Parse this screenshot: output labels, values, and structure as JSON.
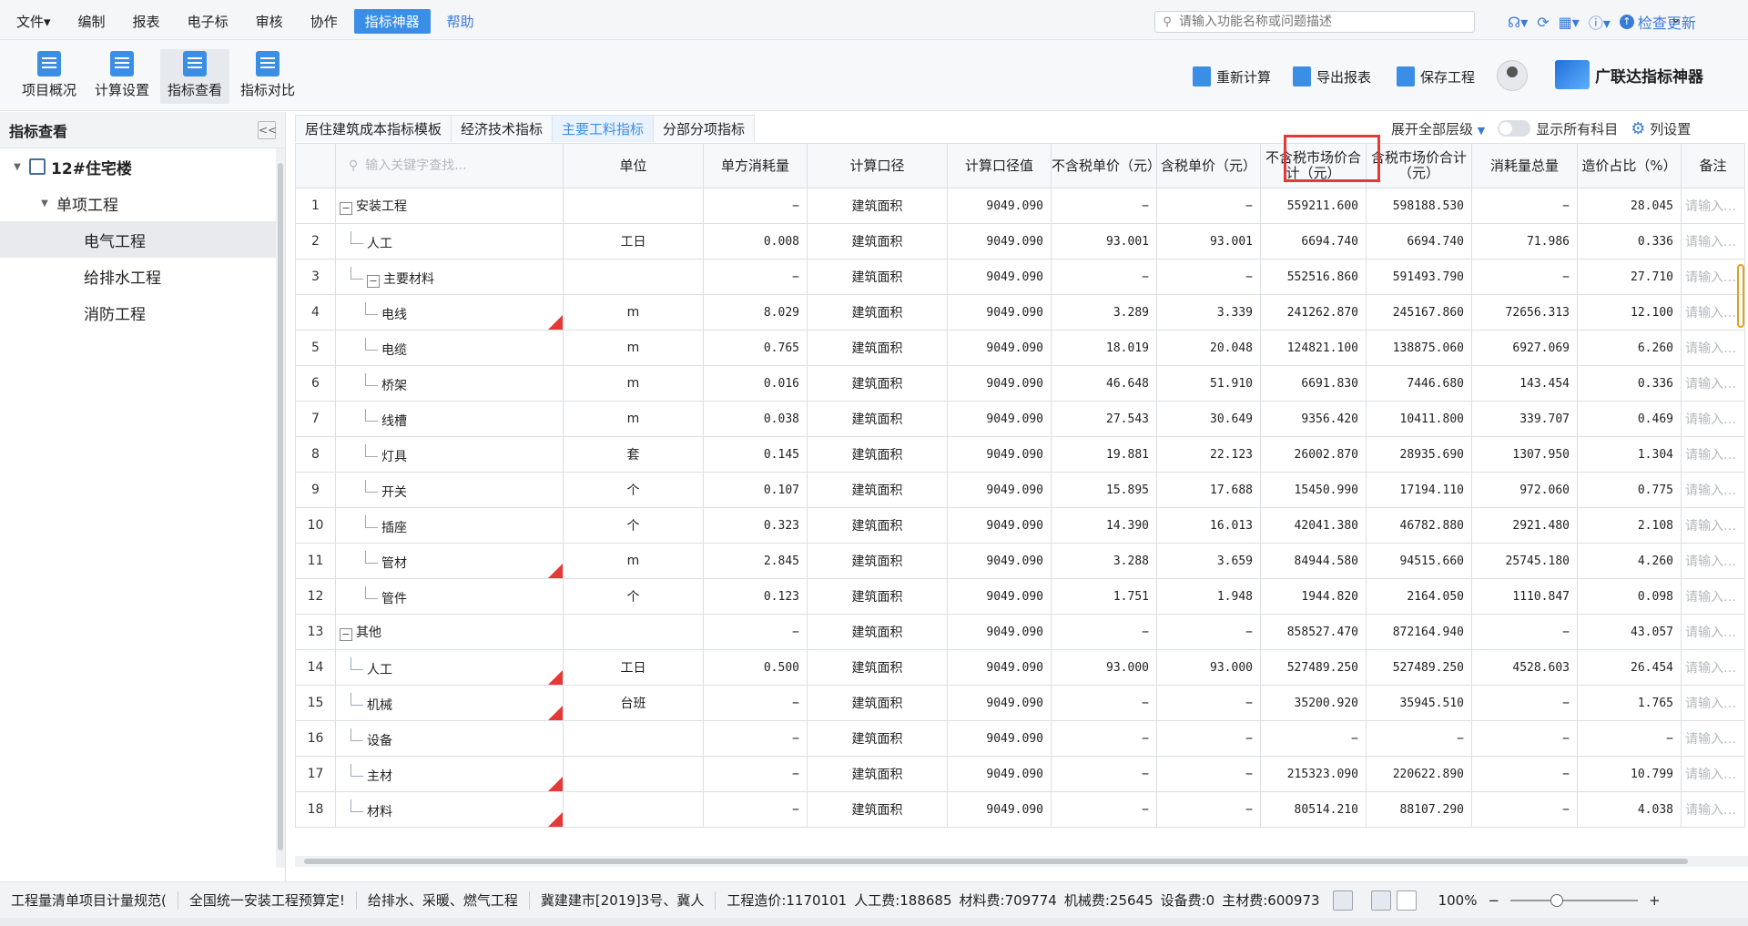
{
  "menubar": {
    "menus": [
      "文件▾",
      "编制",
      "报表",
      "电子标",
      "审核",
      "协作",
      "指标神器",
      "帮助"
    ],
    "active_menu_index": 6,
    "search_placeholder": "请输入功能名称或问题描述",
    "check_update": "检查更新"
  },
  "toolbar": {
    "left_buttons": [
      "项目概况",
      "计算设置",
      "指标查看",
      "指标对比"
    ],
    "active_index": 2,
    "actions": [
      "重新计算",
      "导出报表",
      "保存工程"
    ],
    "brand": "广联达指标神器"
  },
  "leftpanel": {
    "title": "指标查看",
    "collapse": "<<",
    "root": "12#住宅楼",
    "group": "单项工程",
    "items": [
      "电气工程",
      "给排水工程",
      "消防工程"
    ],
    "selected_index": 0
  },
  "tabs": {
    "items": [
      "居住建筑成本指标模板",
      "经济技术指标",
      "主要工料指标",
      "分部分项指标"
    ],
    "active_index": 2,
    "expand_label": "展开全部层级",
    "show_all_label": "显示所有科目",
    "column_settings": "列设置"
  },
  "grid": {
    "search_placeholder": "输入关键字查找...",
    "headers": [
      "单位",
      "单方消耗量",
      "计算口径",
      "计算口径值",
      "不含税单价（元）",
      "含税单价（元）",
      "不含税市场价合计（元）",
      "含税市场价合计（元）",
      "消耗量总量",
      "造价占比（%）",
      "备注"
    ],
    "remark_placeholder": "请输入…",
    "rows": [
      {
        "no": "1",
        "name": "安装工程",
        "level": 0,
        "expand": "−",
        "flag": false,
        "unit": "",
        "per": "−",
        "basis": "建筑面积",
        "bval": "9049.090",
        "p1": "−",
        "p2": "−",
        "t1": "559211.600",
        "t2": "598188.530",
        "qty": "−",
        "pct": "28.045"
      },
      {
        "no": "2",
        "name": "人工",
        "level": 1,
        "expand": "",
        "flag": false,
        "unit": "工日",
        "per": "0.008",
        "basis": "建筑面积",
        "bval": "9049.090",
        "p1": "93.001",
        "p2": "93.001",
        "t1": "6694.740",
        "t2": "6694.740",
        "qty": "71.986",
        "pct": "0.336"
      },
      {
        "no": "3",
        "name": "主要材料",
        "level": 1,
        "expand": "−",
        "flag": false,
        "unit": "",
        "per": "−",
        "basis": "建筑面积",
        "bval": "9049.090",
        "p1": "−",
        "p2": "−",
        "t1": "552516.860",
        "t2": "591493.790",
        "qty": "−",
        "pct": "27.710"
      },
      {
        "no": "4",
        "name": "电线",
        "level": 2,
        "expand": "",
        "flag": true,
        "unit": "m",
        "per": "8.029",
        "basis": "建筑面积",
        "bval": "9049.090",
        "p1": "3.289",
        "p2": "3.339",
        "t1": "241262.870",
        "t2": "245167.860",
        "qty": "72656.313",
        "pct": "12.100"
      },
      {
        "no": "5",
        "name": "电缆",
        "level": 2,
        "expand": "",
        "flag": false,
        "unit": "m",
        "per": "0.765",
        "basis": "建筑面积",
        "bval": "9049.090",
        "p1": "18.019",
        "p2": "20.048",
        "t1": "124821.100",
        "t2": "138875.060",
        "qty": "6927.069",
        "pct": "6.260"
      },
      {
        "no": "6",
        "name": "桥架",
        "level": 2,
        "expand": "",
        "flag": false,
        "unit": "m",
        "per": "0.016",
        "basis": "建筑面积",
        "bval": "9049.090",
        "p1": "46.648",
        "p2": "51.910",
        "t1": "6691.830",
        "t2": "7446.680",
        "qty": "143.454",
        "pct": "0.336"
      },
      {
        "no": "7",
        "name": "线槽",
        "level": 2,
        "expand": "",
        "flag": false,
        "unit": "m",
        "per": "0.038",
        "basis": "建筑面积",
        "bval": "9049.090",
        "p1": "27.543",
        "p2": "30.649",
        "t1": "9356.420",
        "t2": "10411.800",
        "qty": "339.707",
        "pct": "0.469"
      },
      {
        "no": "8",
        "name": "灯具",
        "level": 2,
        "expand": "",
        "flag": false,
        "unit": "套",
        "per": "0.145",
        "basis": "建筑面积",
        "bval": "9049.090",
        "p1": "19.881",
        "p2": "22.123",
        "t1": "26002.870",
        "t2": "28935.690",
        "qty": "1307.950",
        "pct": "1.304"
      },
      {
        "no": "9",
        "name": "开关",
        "level": 2,
        "expand": "",
        "flag": false,
        "unit": "个",
        "per": "0.107",
        "basis": "建筑面积",
        "bval": "9049.090",
        "p1": "15.895",
        "p2": "17.688",
        "t1": "15450.990",
        "t2": "17194.110",
        "qty": "972.060",
        "pct": "0.775"
      },
      {
        "no": "10",
        "name": "插座",
        "level": 2,
        "expand": "",
        "flag": false,
        "unit": "个",
        "per": "0.323",
        "basis": "建筑面积",
        "bval": "9049.090",
        "p1": "14.390",
        "p2": "16.013",
        "t1": "42041.380",
        "t2": "46782.880",
        "qty": "2921.480",
        "pct": "2.108"
      },
      {
        "no": "11",
        "name": "管材",
        "level": 2,
        "expand": "",
        "flag": true,
        "unit": "m",
        "per": "2.845",
        "basis": "建筑面积",
        "bval": "9049.090",
        "p1": "3.288",
        "p2": "3.659",
        "t1": "84944.580",
        "t2": "94515.660",
        "qty": "25745.180",
        "pct": "4.260"
      },
      {
        "no": "12",
        "name": "管件",
        "level": 2,
        "expand": "",
        "flag": false,
        "unit": "个",
        "per": "0.123",
        "basis": "建筑面积",
        "bval": "9049.090",
        "p1": "1.751",
        "p2": "1.948",
        "t1": "1944.820",
        "t2": "2164.050",
        "qty": "1110.847",
        "pct": "0.098"
      },
      {
        "no": "13",
        "name": "其他",
        "level": 0,
        "expand": "−",
        "flag": false,
        "unit": "",
        "per": "−",
        "basis": "建筑面积",
        "bval": "9049.090",
        "p1": "−",
        "p2": "−",
        "t1": "858527.470",
        "t2": "872164.940",
        "qty": "−",
        "pct": "43.057"
      },
      {
        "no": "14",
        "name": "人工",
        "level": 1,
        "expand": "",
        "flag": true,
        "unit": "工日",
        "per": "0.500",
        "basis": "建筑面积",
        "bval": "9049.090",
        "p1": "93.000",
        "p2": "93.000",
        "t1": "527489.250",
        "t2": "527489.250",
        "qty": "4528.603",
        "pct": "26.454"
      },
      {
        "no": "15",
        "name": "机械",
        "level": 1,
        "expand": "",
        "flag": true,
        "unit": "台班",
        "per": "−",
        "basis": "建筑面积",
        "bval": "9049.090",
        "p1": "−",
        "p2": "−",
        "t1": "35200.920",
        "t2": "35945.510",
        "qty": "−",
        "pct": "1.765"
      },
      {
        "no": "16",
        "name": "设备",
        "level": 1,
        "expand": "",
        "flag": false,
        "unit": "",
        "per": "−",
        "basis": "建筑面积",
        "bval": "9049.090",
        "p1": "−",
        "p2": "−",
        "t1": "−",
        "t2": "−",
        "qty": "−",
        "pct": "−"
      },
      {
        "no": "17",
        "name": "主材",
        "level": 1,
        "expand": "",
        "flag": true,
        "unit": "",
        "per": "−",
        "basis": "建筑面积",
        "bval": "9049.090",
        "p1": "−",
        "p2": "−",
        "t1": "215323.090",
        "t2": "220622.890",
        "qty": "−",
        "pct": "10.799"
      },
      {
        "no": "18",
        "name": "材料",
        "level": 1,
        "expand": "",
        "flag": true,
        "unit": "",
        "per": "−",
        "basis": "建筑面积",
        "bval": "9049.090",
        "p1": "−",
        "p2": "−",
        "t1": "80514.210",
        "t2": "88107.290",
        "qty": "−",
        "pct": "4.038"
      }
    ]
  },
  "statusbar": {
    "segments": [
      "工程量清单项目计量规范(",
      "全国统一安装工程预算定!",
      "给排水、采暖、燃气工程",
      "冀建建市[2019]3号、冀人"
    ],
    "costs": [
      "工程造价:1170101",
      "人工费:188685",
      "材料费:709774",
      "机械费:25645",
      "设备费:0",
      "主材费:600973"
    ],
    "zoom": "100%"
  },
  "colors": {
    "accent": "#3a8ee6",
    "highlight": "#e53935",
    "flag": "#e53935"
  }
}
